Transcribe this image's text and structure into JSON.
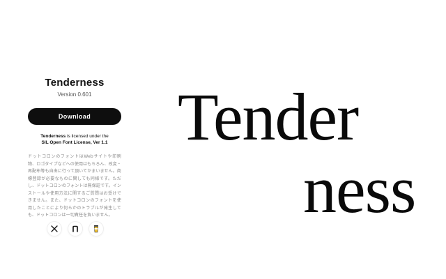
{
  "font": {
    "name": "Tenderness",
    "version": "Version 0.601"
  },
  "actions": {
    "download_label": "Download"
  },
  "license": {
    "font_name": "Tenderness",
    "text_1": " is licensed under the",
    "license_name": "SIL Open Font License, Ver 1.1"
  },
  "notice": {
    "text": "ドットコロンのフォントはWebサイトや印刷物、ロゴタイプなどへの使用はもちろん、改変・再配布等も自由に行って頂いてかまいません。商標登録が必要なものに関しても同様です。ただし、ドットコロンのフォントは無保証です。インストールや使用方法に関するご質問はお受けできません。また、ドットコロンのフォントを使用したことにより何らかのトラブルが発生しても、ドットコロンは一切責任を負いません。"
  },
  "specimen": {
    "line1": "Tender",
    "line2": "ness"
  },
  "social": {
    "items": [
      "x-icon",
      "note-icon",
      "coffee-icon"
    ]
  },
  "colors": {
    "background": "#ffffff",
    "button": "#0e0e0e",
    "text": "#111111",
    "muted": "#888888"
  }
}
